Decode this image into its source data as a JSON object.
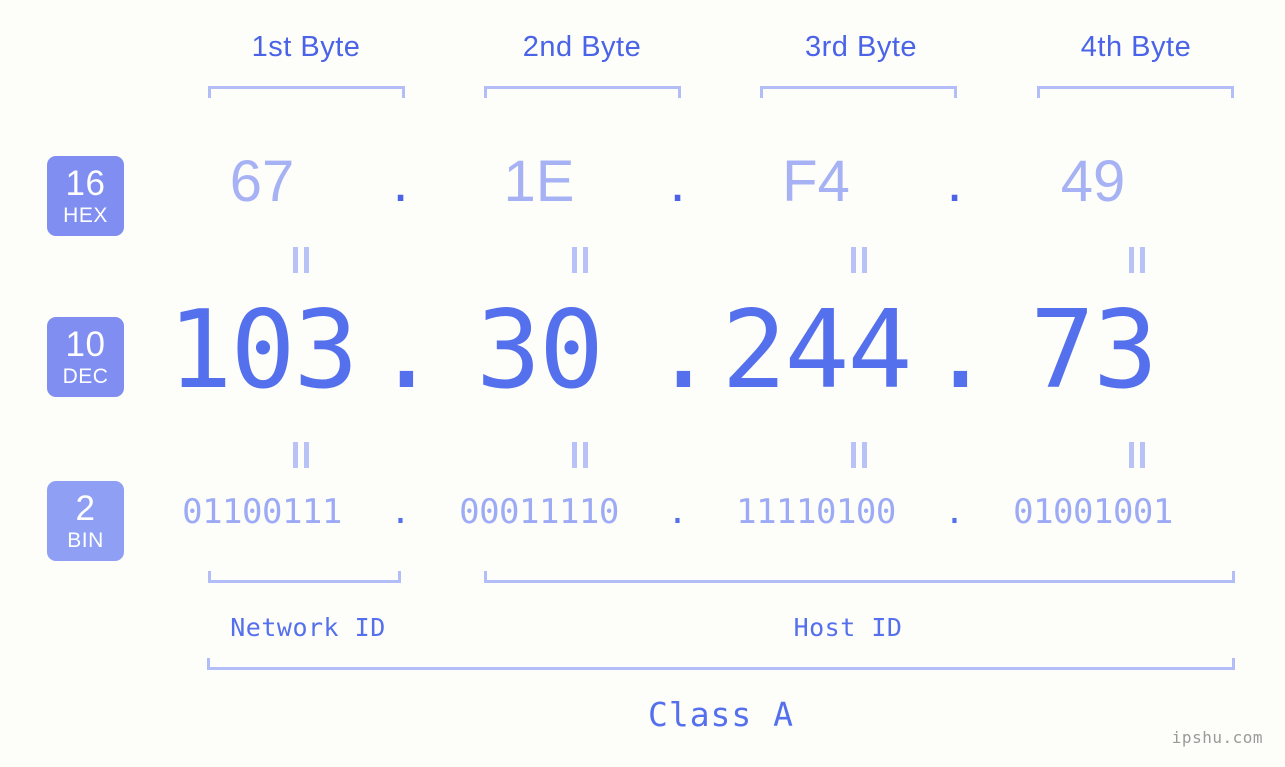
{
  "background_color": "#fdfdfa",
  "colors": {
    "accent_strong": "#4a63e7",
    "accent_mid": "#5570ed",
    "accent_light": "#a7b2f4",
    "bracket": "#b3bdf7",
    "badge_primary": "#7f8ef0",
    "badge_secondary": "#8fa0f4",
    "watermark": "#9a9a9a"
  },
  "byte_headers": [
    {
      "label": "1st Byte"
    },
    {
      "label": "2nd Byte"
    },
    {
      "label": "3rd Byte"
    },
    {
      "label": "4th Byte"
    }
  ],
  "bases": [
    {
      "number": "16",
      "name": "HEX",
      "color": "#7f8ef0"
    },
    {
      "number": "10",
      "name": "DEC",
      "color": "#7f8ef0"
    },
    {
      "number": "2",
      "name": "BIN",
      "color": "#8fa0f4"
    }
  ],
  "separator": ".",
  "rows": {
    "hex": {
      "values": [
        "67",
        "1E",
        "F4",
        "49"
      ]
    },
    "dec": {
      "values": [
        "103",
        "30",
        "244",
        "73"
      ]
    },
    "bin": {
      "values": [
        "01100111",
        "00011110",
        "11110100",
        "01001001"
      ]
    }
  },
  "equals_connector": "||",
  "segments": {
    "network_id": "Network ID",
    "host_id": "Host ID",
    "class": "Class A"
  },
  "watermark": "ipshu.com"
}
